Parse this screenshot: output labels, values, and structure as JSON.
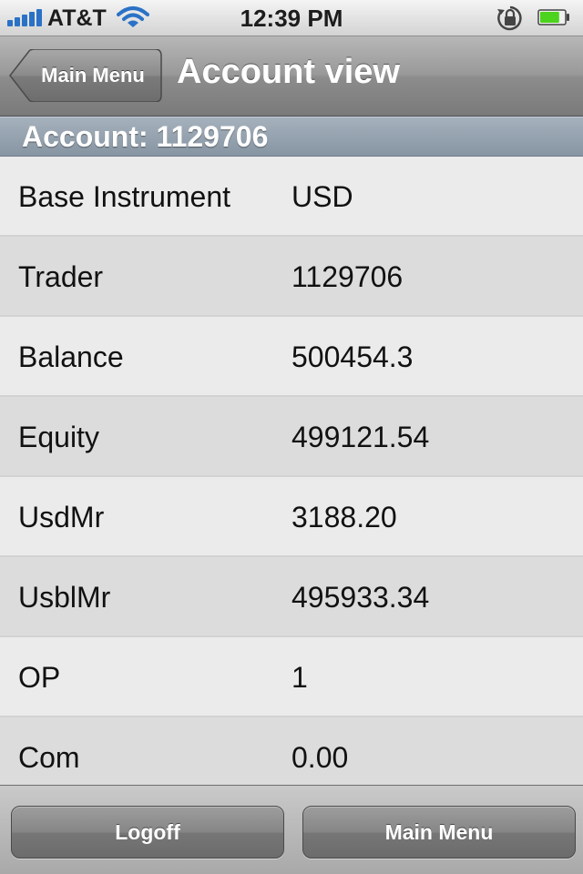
{
  "status_bar": {
    "carrier": "AT&T",
    "time": "12:39 PM",
    "signal_bars": 5,
    "battery_level": 0.8,
    "icons": [
      "signal-icon",
      "wifi-icon",
      "rotation-lock-icon",
      "battery-icon"
    ]
  },
  "nav": {
    "back_label": "Main Menu",
    "title": "Account view"
  },
  "section": {
    "title": "Account: 1129706"
  },
  "rows": [
    {
      "label": "Base Instrument",
      "value": "USD"
    },
    {
      "label": "Trader",
      "value": "1129706"
    },
    {
      "label": "Balance",
      "value": "500454.3"
    },
    {
      "label": "Equity",
      "value": "499121.54"
    },
    {
      "label": "UsdMr",
      "value": "3188.20"
    },
    {
      "label": "UsblMr",
      "value": "495933.34"
    },
    {
      "label": "OP",
      "value": "1"
    },
    {
      "label": "Com",
      "value": "0.00"
    }
  ],
  "toolbar": {
    "logoff_label": "Logoff",
    "main_menu_label": "Main Menu"
  },
  "colors": {
    "accent_blue": "#2a72c6",
    "battery_green": "#4cd31d",
    "section_header": "#8f9dab"
  }
}
